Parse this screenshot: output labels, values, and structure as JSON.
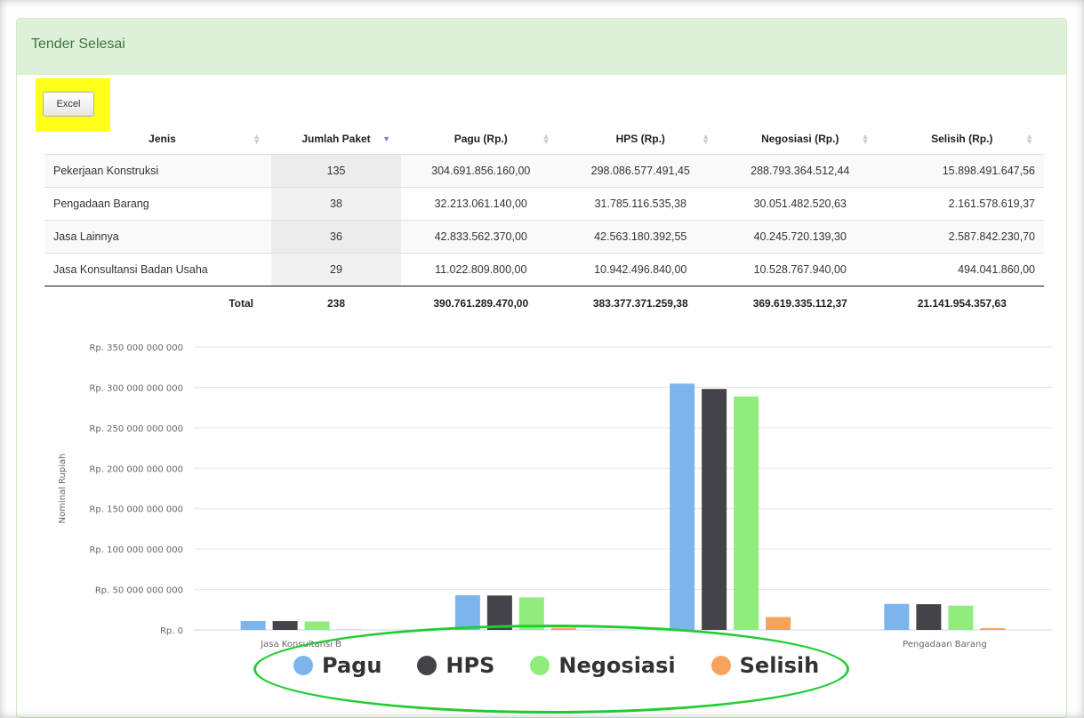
{
  "panel": {
    "title": "Tender Selesai",
    "excel_label": "Excel"
  },
  "table": {
    "headers": [
      "Jenis",
      "Jumlah Paket",
      "Pagu (Rp.)",
      "HPS (Rp.)",
      "Negosiasi (Rp.)",
      "Selisih (Rp.)"
    ],
    "sorted_column": "Jumlah Paket",
    "rows": [
      [
        "Pekerjaan Konstruksi",
        "135",
        "304.691.856.160,00",
        "298.086.577.491,45",
        "288.793.364.512,44",
        "15.898.491.647,56"
      ],
      [
        "Pengadaan Barang",
        "38",
        "32.213.061.140,00",
        "31.785.116.535,38",
        "30.051.482.520,63",
        "2.161.578.619,37"
      ],
      [
        "Jasa Lainnya",
        "36",
        "42.833.562.370,00",
        "42.563.180.392,55",
        "40.245.720.139,30",
        "2.587.842.230,70"
      ],
      [
        "Jasa Konsultansi Badan Usaha",
        "29",
        "11.022.809.800,00",
        "10.942.496.840,00",
        "10.528.767.940,00",
        "494.041.860,00"
      ]
    ],
    "footer": [
      "Total",
      "238",
      "390.761.289.470,00",
      "383.377.371.259,38",
      "369.619.335.112,37",
      "21.141.954.357,63"
    ]
  },
  "chart_data": {
    "type": "bar",
    "title": "",
    "xlabel": "",
    "ylabel": "Nominal Rupiah",
    "ylim": [
      0,
      350000000000
    ],
    "y_ticks": [
      "Rp. 0",
      "Rp. 50 000 000 000",
      "Rp. 100 000 000 000",
      "Rp. 150 000 000 000",
      "Rp. 200 000 000 000",
      "Rp. 250 000 000 000",
      "Rp. 300 000 000 000",
      "Rp. 350 000 000 000"
    ],
    "categories": [
      "Jasa Konsultansi Badan Usaha",
      "Jasa Lainnya",
      "Pekerjaan Konstruksi",
      "Pengadaan Barang"
    ],
    "category_labels_visible": [
      "Jasa Konsultansi B",
      "",
      "",
      "Pengadaan Barang"
    ],
    "grid": true,
    "legend_position": "bottom",
    "series": [
      {
        "name": "Pagu",
        "color": "#7cb5ec",
        "values": [
          11022809800,
          42833562370,
          304691856160,
          32213061140
        ]
      },
      {
        "name": "HPS",
        "color": "#434348",
        "values": [
          10942496840,
          42563180392,
          298086577491,
          31785116535
        ]
      },
      {
        "name": "Negosiasi",
        "color": "#90ed7d",
        "values": [
          10528767940,
          40245720139,
          288793364512,
          30051482520
        ]
      },
      {
        "name": "Selisih",
        "color": "#f7a35c",
        "values": [
          494041860,
          2587842230,
          15898491647,
          2161578619
        ]
      }
    ]
  }
}
